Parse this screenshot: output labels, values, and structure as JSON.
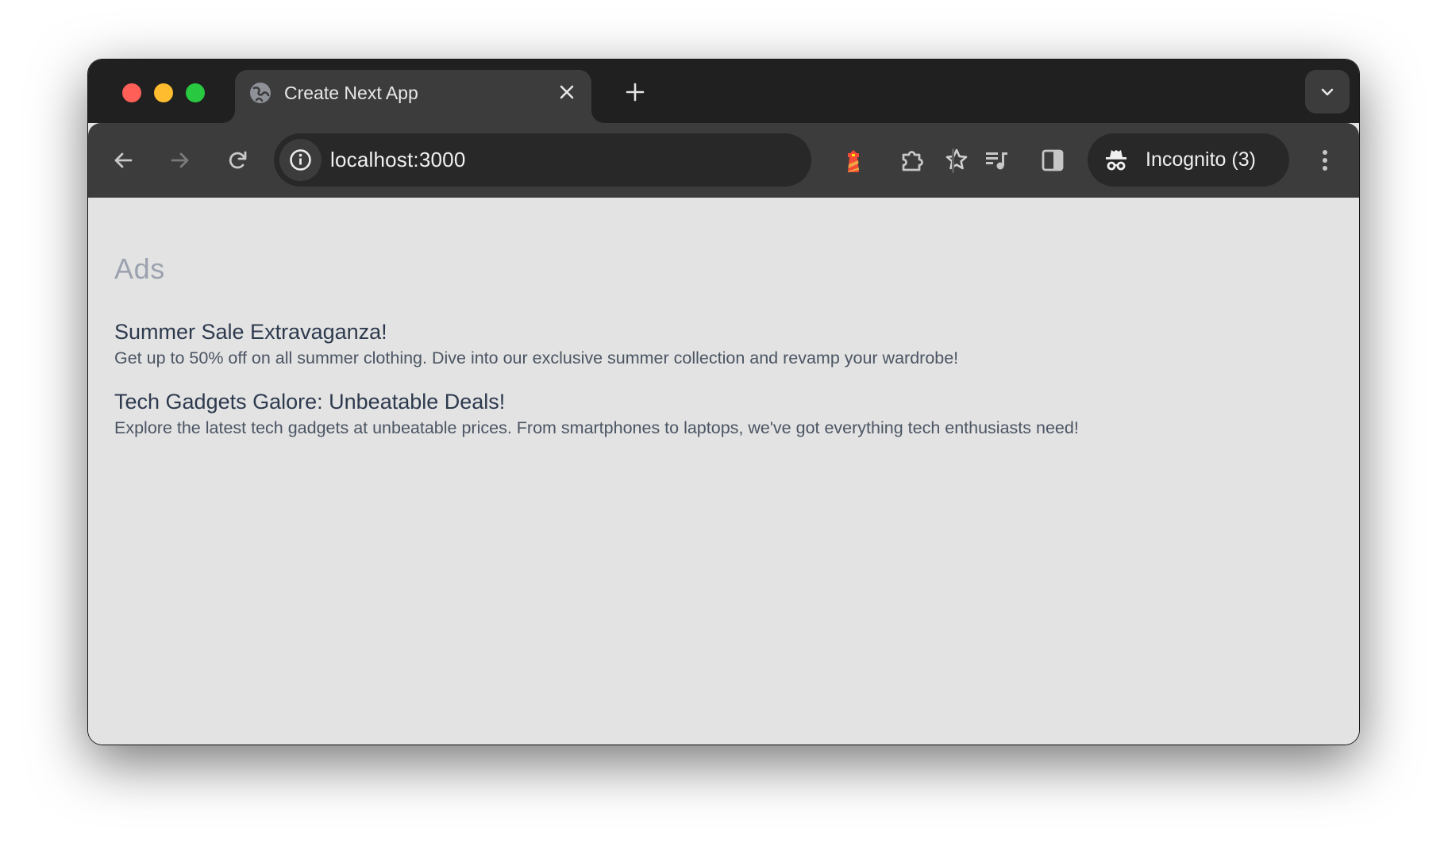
{
  "browser": {
    "window_controls": {
      "close_color": "#ff5f57",
      "minimize_color": "#febc2e",
      "maximize_color": "#28c840"
    },
    "tabs": [
      {
        "title": "Create Next App",
        "favicon": "globe-icon",
        "active": true
      }
    ],
    "new_tab_icon": "plus-icon",
    "tab_search_icon": "chevron-down-icon",
    "toolbar": {
      "back_icon": "arrow-left-icon",
      "forward_icon": "arrow-right-icon",
      "reload_icon": "reload-icon",
      "site_info_icon": "info-icon",
      "url": "localhost:3000",
      "bookmark_icon": "star-icon",
      "extensions": [
        {
          "name": "lighthouse-extension",
          "icon": "lighthouse-icon"
        },
        {
          "name": "extensions-menu",
          "icon": "puzzle-icon"
        }
      ],
      "media_control_icon": "media-queue-icon",
      "side_panel_icon": "side-panel-icon",
      "profile": {
        "label": "Incognito (3)",
        "icon": "incognito-icon"
      },
      "menu_icon": "kebab-menu-icon"
    }
  },
  "page": {
    "heading": "Ads",
    "ads": [
      {
        "title": "Summer Sale Extravaganza!",
        "description": "Get up to 50% off on all summer clothing. Dive into our exclusive summer collection and revamp your wardrobe!"
      },
      {
        "title": "Tech Gadgets Galore: Unbeatable Deals!",
        "description": "Explore the latest tech gadgets at unbeatable prices. From smartphones to laptops, we've got everything tech enthusiasts need!"
      }
    ],
    "colors": {
      "background": "#e3e3e3",
      "heading": "#9ca3af",
      "ad_title": "#2d3a4e",
      "ad_description": "#4b5563"
    }
  }
}
